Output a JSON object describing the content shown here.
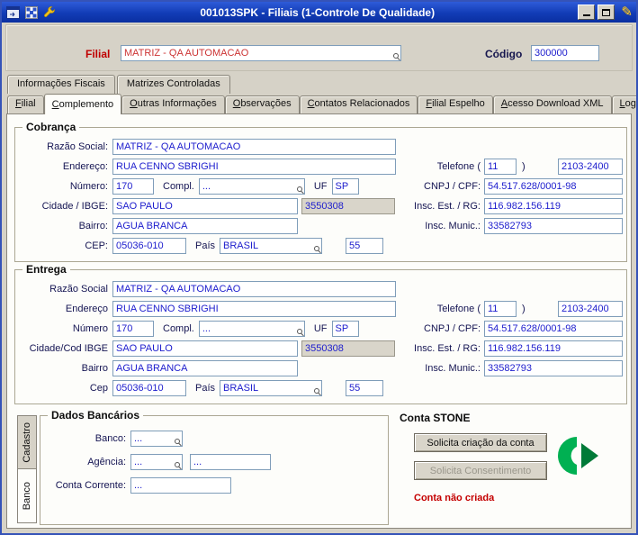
{
  "colors": {
    "titlebar_blue": "#123cb6",
    "field_text_blue": "#1c1ccd",
    "required_red": "#cc3333",
    "status_red": "#c40000",
    "stone_green": "#00b052"
  },
  "icons": {
    "pencil": "✎"
  },
  "titlebar": {
    "title": "001013SPK - Filiais (1-Controle De Qualidade)"
  },
  "header": {
    "filial_label": "Filial",
    "filial_value": "MATRIZ - QA AUTOMACAO",
    "codigo_label": "Código",
    "codigo_value": "300000"
  },
  "tabs": {
    "top": [
      {
        "label": "Informações Fiscais"
      },
      {
        "label": "Matrizes Controladas"
      }
    ],
    "main": [
      {
        "label": "Filial"
      },
      {
        "label": "Complemento"
      },
      {
        "label": "Outras Informações"
      },
      {
        "label": "Observações"
      },
      {
        "label": "Contatos Relacionados"
      },
      {
        "label": "Filial Espelho"
      },
      {
        "label": "Acesso Download XML"
      },
      {
        "label": "Log"
      }
    ],
    "active": "Complemento"
  },
  "cobranca": {
    "title": "Cobrança",
    "labels": {
      "razao": "Razão Social:",
      "endereco": "Endereço:",
      "numero": "Número:",
      "compl": "Compl.",
      "uf": "UF",
      "cidade": "Cidade / IBGE:",
      "bairro": "Bairro:",
      "cep": "CEP:",
      "pais": "País",
      "telefone_open": "Telefone (",
      "telefone_close": ")",
      "cnpj": "CNPJ / CPF:",
      "insc_est": "Insc. Est. / RG:",
      "insc_mun": "Insc. Munic.:"
    },
    "values": {
      "razao": "MATRIZ - QA AUTOMACAO",
      "endereco": "RUA CENNO SBRIGHI",
      "numero": "170",
      "compl": "...",
      "uf": "SP",
      "cidade": "SAO PAULO",
      "ibge": "3550308",
      "bairro": "AGUA BRANCA",
      "cep": "05036-010",
      "pais": "BRASIL",
      "ddi": "55",
      "ddd": "11",
      "fone": "2103-2400",
      "cnpj": "54.517.628/0001-98",
      "insc_est": "116.982.156.119",
      "insc_mun": "33582793"
    }
  },
  "entrega": {
    "title": "Entrega",
    "labels": {
      "razao": "Razão Social",
      "endereco": "Endereço",
      "numero": "Número",
      "compl": "Compl.",
      "uf": "UF",
      "cidade": "Cidade/Cod IBGE",
      "bairro": "Bairro",
      "cep": "Cep",
      "pais": "País",
      "telefone_open": "Telefone (",
      "telefone_close": ")",
      "cnpj": "CNPJ / CPF:",
      "insc_est": "Insc. Est. / RG:",
      "insc_mun": "Insc. Munic.:"
    },
    "values": {
      "razao": "MATRIZ - QA AUTOMACAO",
      "endereco": "RUA CENNO SBRIGHI",
      "numero": "170",
      "compl": "...",
      "uf": "SP",
      "cidade": "SAO PAULO",
      "ibge": "3550308",
      "bairro": "AGUA BRANCA",
      "cep": "05036-010",
      "pais": "BRASIL",
      "ddi": "55",
      "ddd": "11",
      "fone": "2103-2400",
      "cnpj": "54.517.628/0001-98",
      "insc_est": "116.982.156.119",
      "insc_mun": "33582793"
    }
  },
  "bottom": {
    "side_tabs": [
      {
        "label": "Cadastro"
      },
      {
        "label": "Banco"
      }
    ],
    "active_side_tab": "Banco",
    "dados": {
      "title": "Dados Bancários",
      "labels": {
        "banco": "Banco:",
        "agencia": "Agência:",
        "conta": "Conta Corrente:"
      },
      "values": {
        "banco": "...",
        "agencia1": "...",
        "agencia2": "...",
        "conta": "..."
      }
    },
    "stone": {
      "title": "Conta STONE",
      "btn_criacao": "Solicita criação da conta",
      "btn_consentimento": "Solicita Consentimento",
      "status": "Conta não criada"
    }
  }
}
